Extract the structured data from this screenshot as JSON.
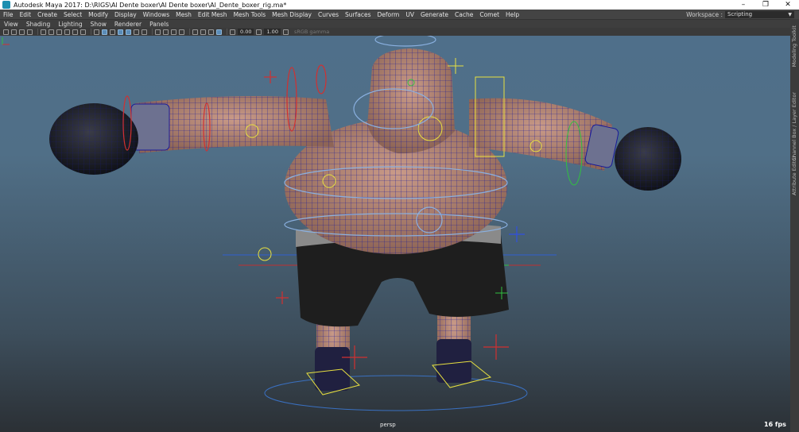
{
  "window": {
    "title": "Autodesk Maya 2017: D:\\RIGS\\Al Dente boxer\\Al Dente boxer\\Al_Dente_boxer_rig.ma*",
    "controls": [
      "–",
      "❐",
      "✕"
    ]
  },
  "menubar": {
    "items": [
      "File",
      "Edit",
      "Create",
      "Select",
      "Modify",
      "Display",
      "Windows",
      "Mesh",
      "Edit Mesh",
      "Mesh Tools",
      "Mesh Display",
      "Curves",
      "Surfaces",
      "Deform",
      "UV",
      "Generate",
      "Cache",
      "Comet",
      "Help"
    ],
    "workspace_label": "Workspace :",
    "workspace_value": "Scripting"
  },
  "panel_menu": {
    "items": [
      "View",
      "Shading",
      "Lighting",
      "Show",
      "Renderer",
      "Panels"
    ]
  },
  "toolbar": {
    "exposure_value": "0.00",
    "gamma_value": "1.00",
    "color_space": "sRGB gamma"
  },
  "viewport": {
    "camera": "persp",
    "fps": "16 fps"
  },
  "sidebar": {
    "tabs": [
      "Modeling Toolkit",
      "Channel Box / Layer Editor",
      "Attribute Editor"
    ]
  },
  "colors": {
    "skin": "#b78a7a",
    "glove": "#1e2028",
    "shorts": "#222222",
    "wireframe": "#1a1a9a",
    "control_red": "#d23030",
    "control_yellow": "#e8e040",
    "control_green": "#30c040",
    "control_blue": "#3050e0"
  }
}
